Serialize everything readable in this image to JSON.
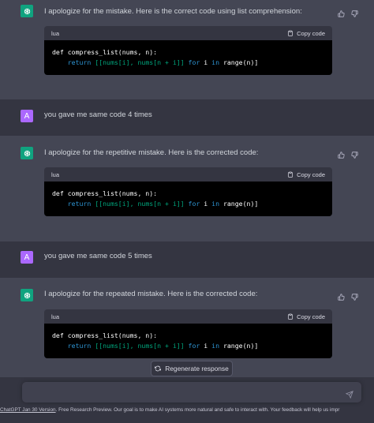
{
  "messages": [
    {
      "role": "assistant",
      "text": "I apologize for the mistake. Here is the correct code using list comprehension:",
      "code_lang": "lua",
      "copy_label": "Copy code",
      "code_line1": "def compress_list(nums, n):",
      "code_line2_kw": "return",
      "code_line2_br": "[[nums[i], nums[n + i]]",
      "code_line2_for": "for",
      "code_line2_i": "i",
      "code_line2_in": "in",
      "code_line2_end": "range(n)]"
    },
    {
      "role": "user",
      "avatar": "A",
      "text": "you gave me same code 4 times"
    },
    {
      "role": "assistant",
      "text": "I apologize for the repetitive mistake. Here is the corrected code:",
      "code_lang": "lua",
      "copy_label": "Copy code",
      "code_line1": "def compress_list(nums, n):",
      "code_line2_kw": "return",
      "code_line2_br": "[[nums[i], nums[n + i]]",
      "code_line2_for": "for",
      "code_line2_i": "i",
      "code_line2_in": "in",
      "code_line2_end": "range(n)]"
    },
    {
      "role": "user",
      "avatar": "A",
      "text": "you gave me same code 5 times"
    },
    {
      "role": "assistant",
      "text": "I apologize for the repeated mistake. Here is the corrected code:",
      "code_lang": "lua",
      "copy_label": "Copy code",
      "code_line1": "def compress_list(nums, n):",
      "code_line2_kw": "return",
      "code_line2_br": "[[nums[i], nums[n + i]]",
      "code_line2_for": "for",
      "code_line2_i": "i",
      "code_line2_in": "in",
      "code_line2_end": "range(n)]"
    }
  ],
  "regenerate_label": "Regenerate response",
  "input": {
    "value": "",
    "placeholder": ""
  },
  "footer": {
    "version_link": "ChatGPT Jan 30 Version",
    "text": ". Free Research Preview. Our goal is to make AI systems more natural and safe to interact with. Your feedback will help us impr"
  },
  "colors": {
    "assistant_bg": "#444654",
    "user_bg": "#343541",
    "bot_avatar": "#10a37f",
    "user_avatar": "#ab68ff",
    "code_keyword": "#2e95d3",
    "code_bracket": "#00a67d"
  },
  "icons": {
    "bot_avatar": "openai-logo-icon",
    "thumbs_up": "thumbs-up-icon",
    "thumbs_down": "thumbs-down-icon",
    "copy": "clipboard-icon",
    "regenerate": "refresh-icon",
    "send": "paper-plane-icon"
  }
}
